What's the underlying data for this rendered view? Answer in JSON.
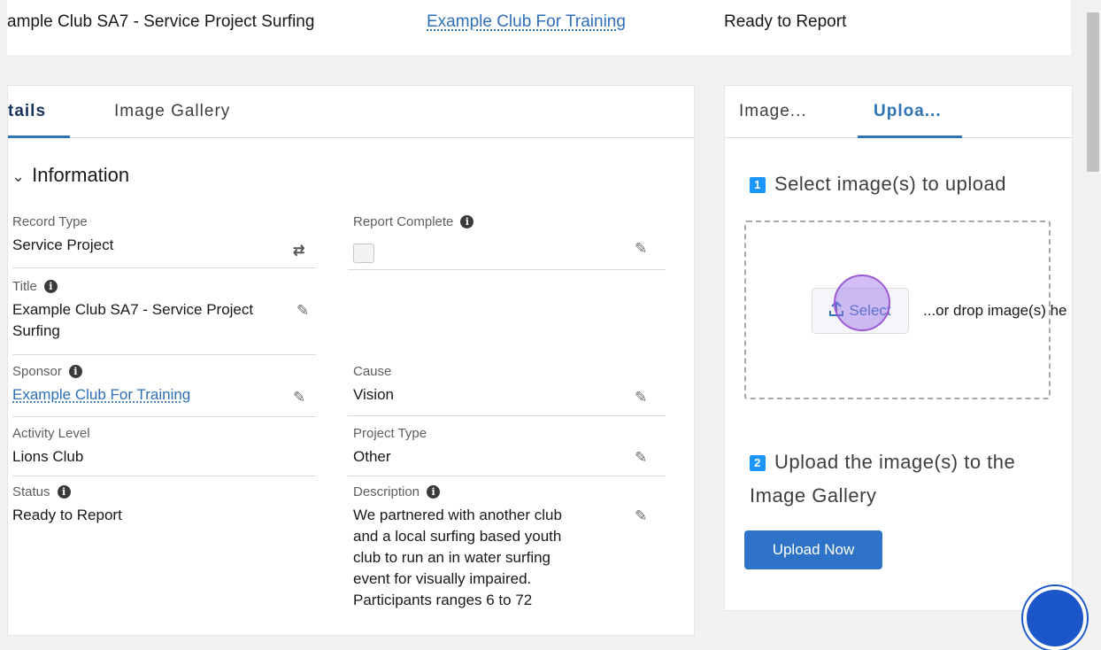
{
  "header": {
    "project_name": "ample Club SA7 - Service Project Surfing",
    "sponsor_link": "Example Club For Training",
    "status": "Ready to Report"
  },
  "left_tabs": [
    {
      "label": "tails",
      "active": true
    },
    {
      "label": "Image Gallery",
      "active": false
    }
  ],
  "section": {
    "title": "Information"
  },
  "fields": {
    "record_type": {
      "label": "Record Type",
      "value": "Service Project"
    },
    "report_complete": {
      "label": "Report Complete",
      "checked": false
    },
    "title": {
      "label": "Title",
      "value_line1": "Example Club SA7 - Service Project",
      "value_line2": "Surfing"
    },
    "sponsor": {
      "label": "Sponsor",
      "value": "Example Club For Training"
    },
    "cause": {
      "label": "Cause",
      "value": "Vision"
    },
    "activity_level": {
      "label": "Activity Level",
      "value": "Lions Club"
    },
    "project_type": {
      "label": "Project Type",
      "value": "Other"
    },
    "status": {
      "label": "Status",
      "value": "Ready to Report"
    },
    "description": {
      "label": "Description",
      "lines": [
        "We partnered with another club",
        "and a local surfing based youth",
        "club to run an in water surfing",
        "event for visually impaired.",
        "Participants ranges 6 to 72"
      ]
    }
  },
  "right_tabs": [
    {
      "label": "Image...",
      "active": false
    },
    {
      "label": "Uploa...",
      "active": true
    }
  ],
  "upload": {
    "step1_num": "1",
    "step1_text": "Select image(s) to upload",
    "select_label": "Select",
    "drop_text": "...or drop image(s) he",
    "step2_num": "2",
    "step2_line1": "Upload the image(s) to the",
    "step2_line2": "Image Gallery",
    "upload_button": "Upload Now"
  },
  "icons": {
    "info": "info-icon",
    "pencil": "pencil-icon",
    "change_record_type": "change-record-type-icon",
    "upload": "upload-icon",
    "chevron": "chevron-down-icon",
    "help": "help-icon"
  },
  "colors": {
    "link": "#2e6fb8",
    "primary_button": "#2e73c8",
    "step_badge": "#1b96ff",
    "active_tab_underline": "#2e73b8"
  }
}
